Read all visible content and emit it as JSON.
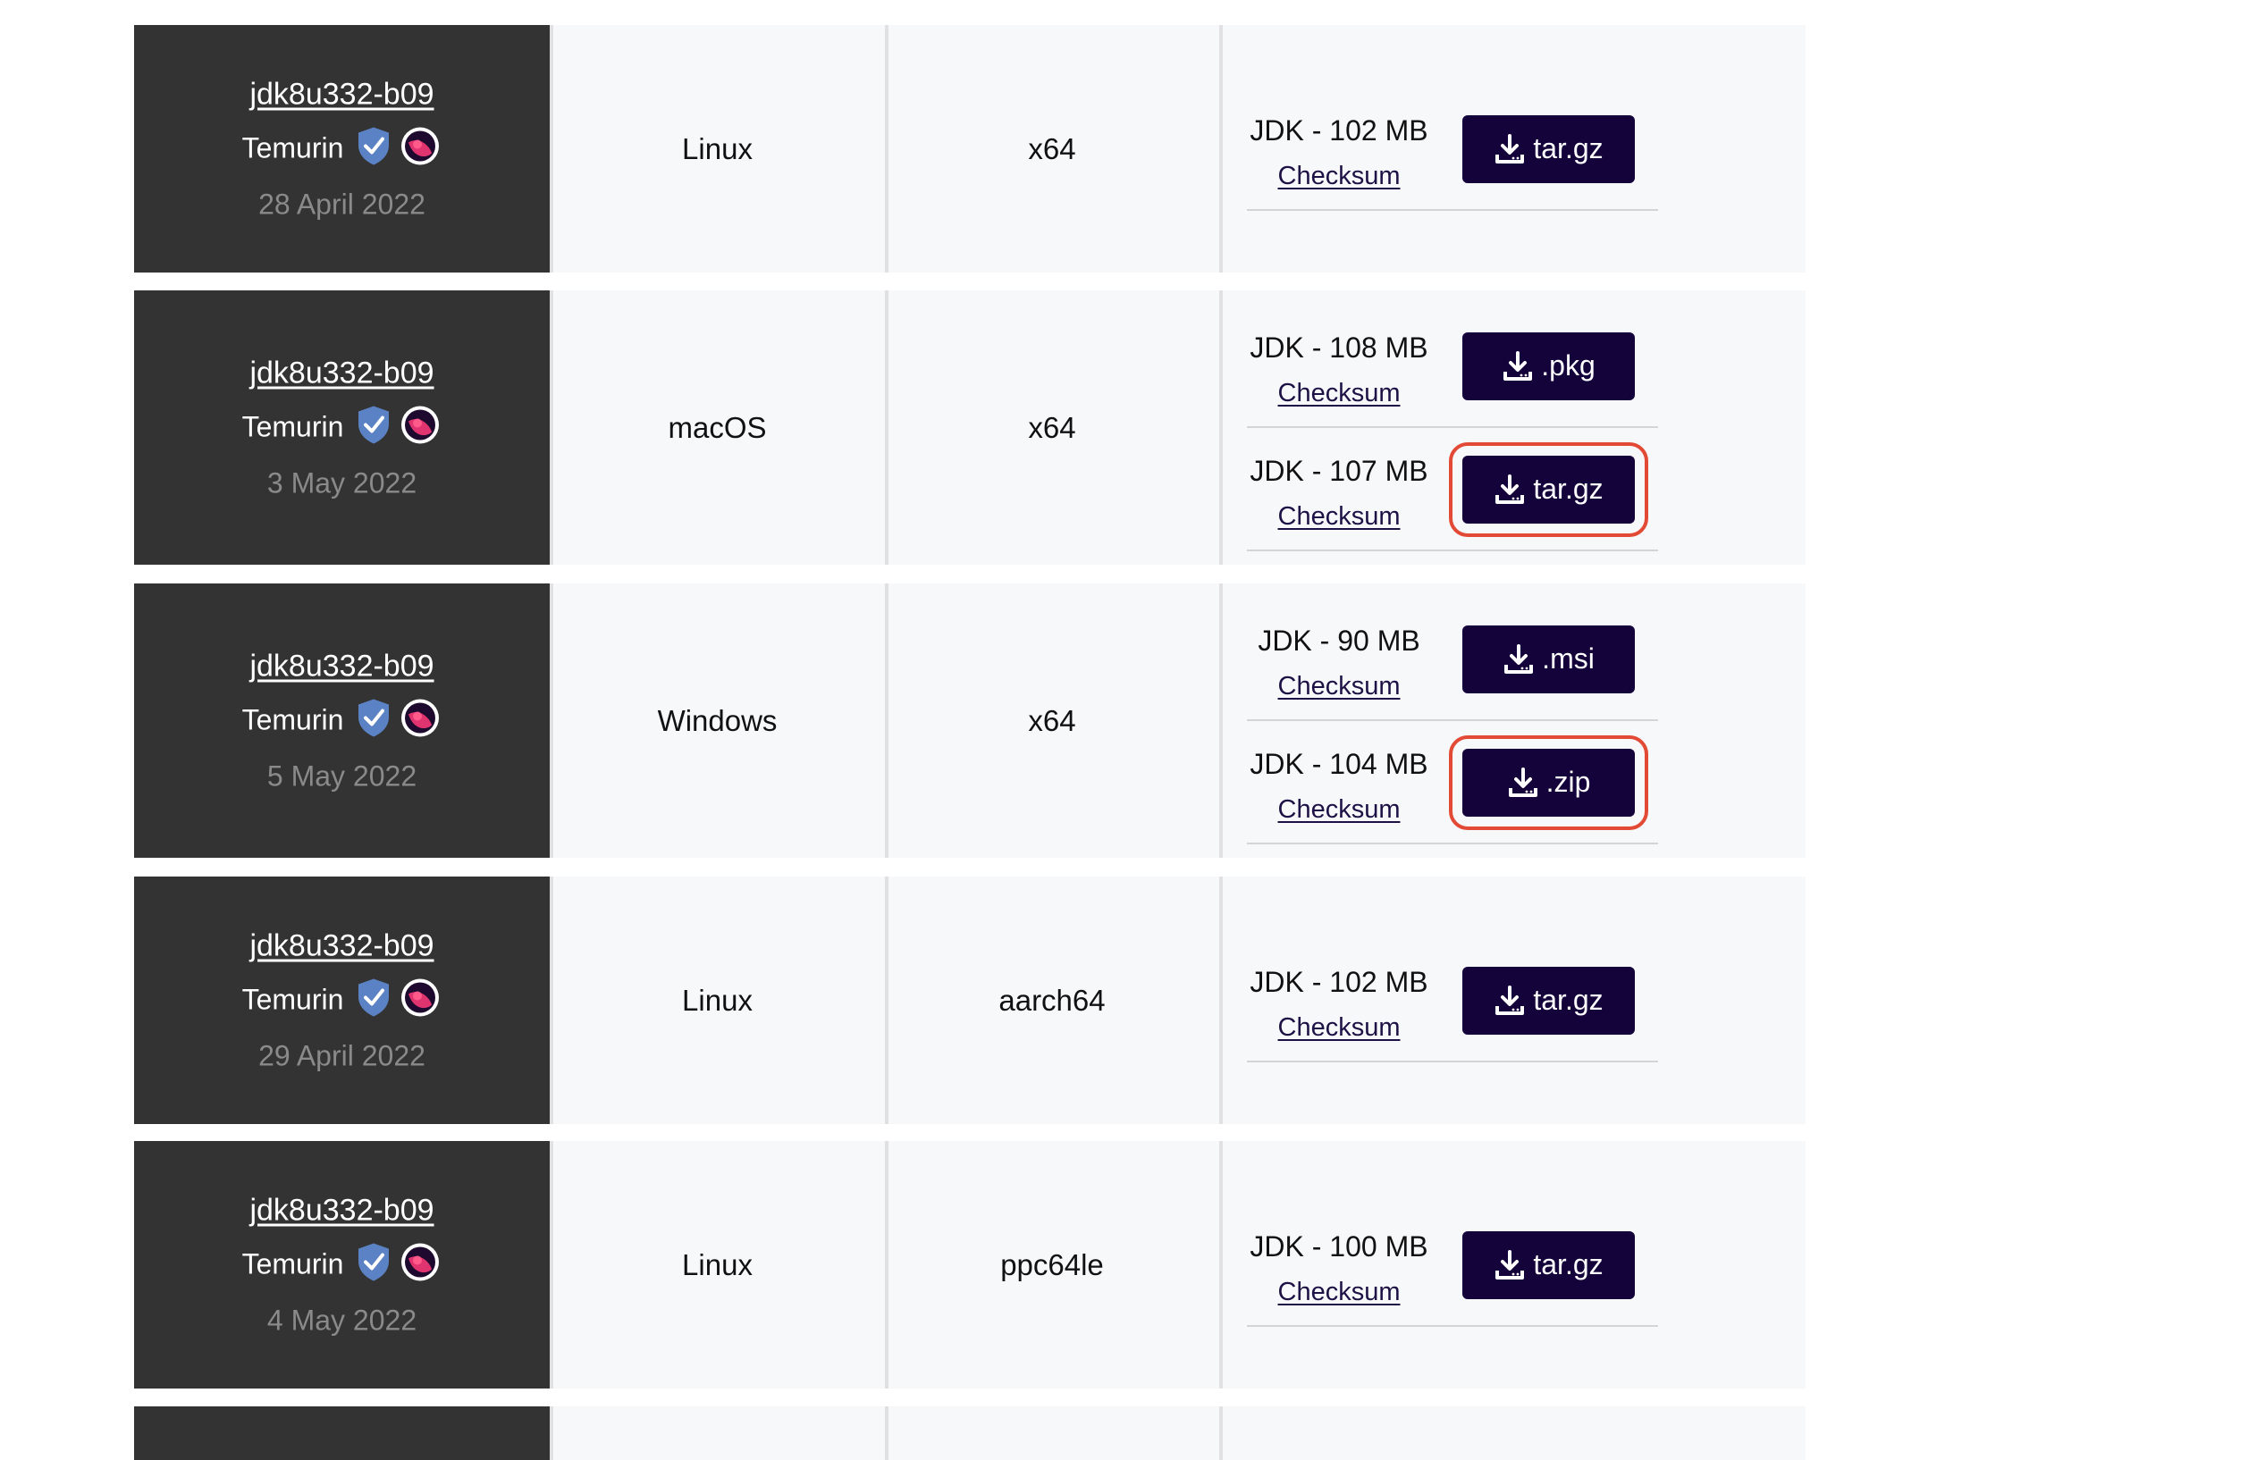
{
  "rows": [
    {
      "release": "jdk8u332-b09",
      "vendor": "Temurin",
      "date": "28 April 2022",
      "os": "Linux",
      "arch": "x64",
      "packages": [
        {
          "size": "JDK - 102 MB",
          "checksum": "Checksum",
          "button": "tar.gz",
          "highlighted": false
        }
      ]
    },
    {
      "release": "jdk8u332-b09",
      "vendor": "Temurin",
      "date": "3 May 2022",
      "os": "macOS",
      "arch": "x64",
      "packages": [
        {
          "size": "JDK - 108 MB",
          "checksum": "Checksum",
          "button": ".pkg",
          "highlighted": false
        },
        {
          "size": "JDK - 107 MB",
          "checksum": "Checksum",
          "button": "tar.gz",
          "highlighted": true
        }
      ]
    },
    {
      "release": "jdk8u332-b09",
      "vendor": "Temurin",
      "date": "5 May 2022",
      "os": "Windows",
      "arch": "x64",
      "packages": [
        {
          "size": "JDK - 90 MB",
          "checksum": "Checksum",
          "button": ".msi",
          "highlighted": false
        },
        {
          "size": "JDK - 104 MB",
          "checksum": "Checksum",
          "button": ".zip",
          "highlighted": true
        }
      ]
    },
    {
      "release": "jdk8u332-b09",
      "vendor": "Temurin",
      "date": "29 April 2022",
      "os": "Linux",
      "arch": "aarch64",
      "packages": [
        {
          "size": "JDK - 102 MB",
          "checksum": "Checksum",
          "button": "tar.gz",
          "highlighted": false
        }
      ]
    },
    {
      "release": "jdk8u332-b09",
      "vendor": "Temurin",
      "date": "4 May 2022",
      "os": "Linux",
      "arch": "ppc64le",
      "packages": [
        {
          "size": "JDK - 100 MB",
          "checksum": "Checksum",
          "button": "tar.gz",
          "highlighted": false
        }
      ]
    },
    {
      "release": "",
      "vendor": "",
      "date": "",
      "os": "",
      "arch": "",
      "packages": []
    }
  ],
  "icons": {
    "verified": "shield-check-icon",
    "vendor_logo": "temurin-logo-icon",
    "download": "download-icon"
  },
  "colors": {
    "release_cell_bg": "#333333",
    "row_bg": "#f7f8fa",
    "button_bg": "#14023a",
    "highlight": "#e24a36",
    "shield": "#5b82c4",
    "logo": "#e03470"
  }
}
